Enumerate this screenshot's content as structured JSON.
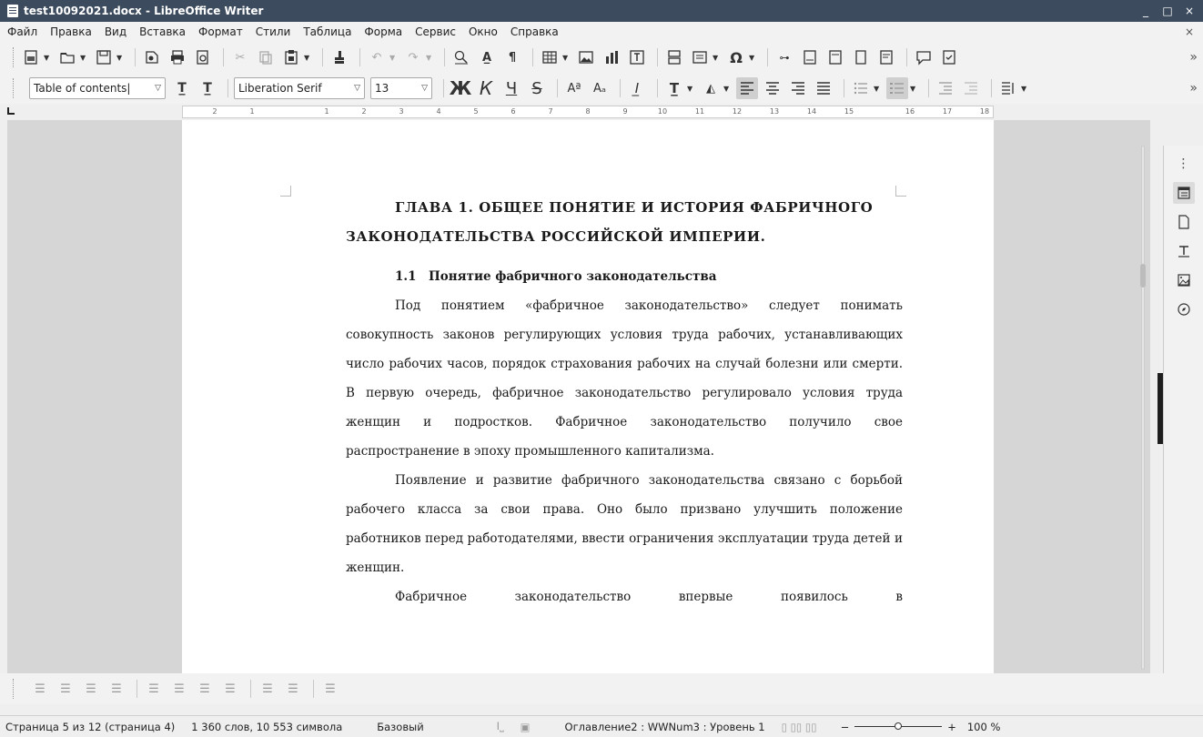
{
  "window": {
    "title": "test10092021.docx - LibreOffice Writer",
    "controls": [
      "_",
      "□",
      "×"
    ]
  },
  "menubar": {
    "items": [
      "Файл",
      "Правка",
      "Вид",
      "Вставка",
      "Формат",
      "Стили",
      "Таблица",
      "Форма",
      "Сервис",
      "Окно",
      "Справка"
    ],
    "close_doc": "×"
  },
  "formatting": {
    "paragraph_style": "Table of contents|",
    "font_name": "Liberation Serif",
    "font_size": "13",
    "bold_label": "Ж",
    "italic_label": "К",
    "underline_label": "Ч",
    "strike_label": "S"
  },
  "ruler": {
    "ticks": [
      "2",
      "1",
      "1",
      "2",
      "3",
      "4",
      "5",
      "6",
      "7",
      "8",
      "9",
      "10",
      "11",
      "12",
      "13",
      "14",
      "15",
      "16",
      "17",
      "18"
    ]
  },
  "document": {
    "heading_line1": "ГЛАВА 1. ОБЩЕЕ ПОНЯТИЕ И ИСТОРИЯ ФАБРИЧНОГО",
    "heading_line2": "ЗАКОНОДАТЕЛЬСТВА РОССИЙСКОЙ ИМПЕРИИ.",
    "subheading": "1.1 Понятие фабричного законодательства",
    "paragraphs": [
      "Под понятием «фабричное законодательство» следует понимать совокупность законов регулирующих условия труда рабочих, устанавливающих число рабочих часов, порядок страхования рабочих на случай болезни или смерти. В первую очередь, фабричное законодательство регулировало условия труда женщин и подростков. Фабричное законодательство получило свое распространение в эпоху промышленного капитализма.",
      "Появление и развитие фабричного законодательства связано с борьбой рабочего класса за свои права. Оно было призвано улучшить положение работников перед работодателями, ввести ограничения эксплуатации труда детей и женщин.",
      "Фабричное законодательство впервые появилось в"
    ]
  },
  "statusbar": {
    "page": "Страница 5 из 12 (страница 4)",
    "words": "1 360 слов, 10 553 символа",
    "page_style": "Базовый",
    "outline": "Оглавление2 : WWNum3 : Уровень 1",
    "zoom_minus": "−",
    "zoom_plus": "+",
    "zoom": "100 %"
  },
  "sidebar": {
    "icons": [
      "properties-icon",
      "page-icon",
      "styles-icon",
      "gallery-icon",
      "navigator-icon"
    ]
  }
}
